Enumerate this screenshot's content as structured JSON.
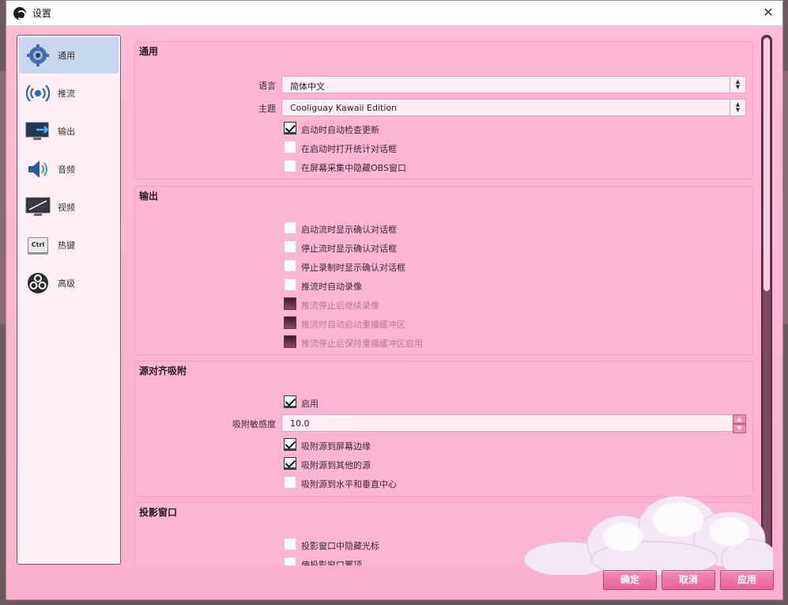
{
  "window": {
    "title": "设置",
    "close_label": "✕"
  },
  "sidebar": {
    "items": [
      {
        "label": "通用",
        "icon": "gear-icon"
      },
      {
        "label": "推流",
        "icon": "broadcast-icon"
      },
      {
        "label": "输出",
        "icon": "output-monitor-icon"
      },
      {
        "label": "音频",
        "icon": "speaker-icon"
      },
      {
        "label": "视频",
        "icon": "video-monitor-icon"
      },
      {
        "label": "热键",
        "icon": "ctrl-key-icon"
      },
      {
        "label": "高级",
        "icon": "obs-logo-icon"
      }
    ],
    "ctrl_text": "Ctrl"
  },
  "general": {
    "title": "通用",
    "language_label": "语言",
    "language_value": "简体中文",
    "theme_label": "主题",
    "theme_value": "Cooliguay Kawaii Edition",
    "checkboxes": [
      {
        "label": "启动时自动检查更新",
        "checked": true
      },
      {
        "label": "在启动时打开统计对话框",
        "checked": false
      },
      {
        "label": "在屏幕采集中隐藏OBS窗口",
        "checked": false
      }
    ]
  },
  "output": {
    "title": "输出",
    "checkboxes": [
      {
        "label": "启动流时显示确认对话框",
        "checked": false,
        "disabled": false
      },
      {
        "label": "停止流时显示确认对话框",
        "checked": false,
        "disabled": false
      },
      {
        "label": "停止录制时显示确认对话框",
        "checked": false,
        "disabled": false
      },
      {
        "label": "推流时自动录像",
        "checked": false,
        "disabled": false
      },
      {
        "label": "推流停止后继续录像",
        "checked": false,
        "disabled": true
      },
      {
        "label": "推流时自动启动重播缓冲区",
        "checked": false,
        "disabled": true
      },
      {
        "label": "推流停止后保持重播缓冲区启用",
        "checked": false,
        "disabled": true
      }
    ]
  },
  "snapping": {
    "title": "源对齐吸附",
    "enable_label": "启用",
    "enable_checked": true,
    "sensitivity_label": "吸附敏感度",
    "sensitivity_value": "10.0",
    "checkboxes": [
      {
        "label": "吸附源到屏幕边缘",
        "checked": true
      },
      {
        "label": "吸附源到其他的源",
        "checked": true
      },
      {
        "label": "吸附源到水平和垂直中心",
        "checked": false
      }
    ]
  },
  "projector": {
    "title": "投影窗口",
    "checkboxes": [
      {
        "label": "投影窗口中隐藏光标",
        "checked": false
      },
      {
        "label": "使投影窗口置顶",
        "checked": false
      }
    ]
  },
  "buttons": {
    "ok": "确定",
    "cancel": "取消",
    "apply": "应用"
  },
  "colors": {
    "accent": "#f579a8",
    "background": "#fbb9d3"
  }
}
